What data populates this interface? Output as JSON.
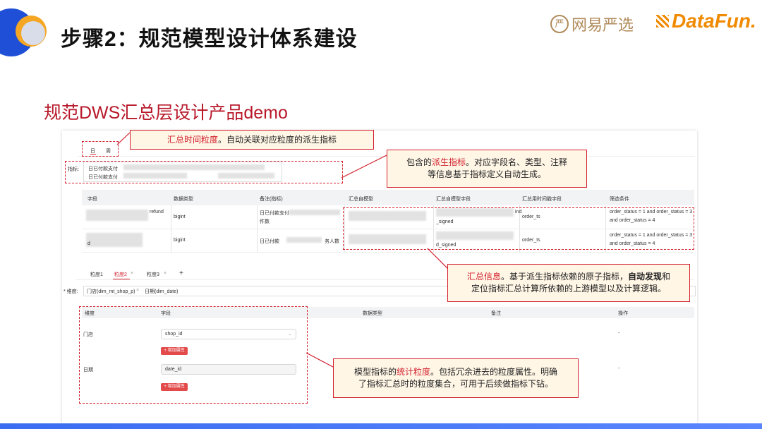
{
  "header": {
    "title": "步骤2：规范模型设计体系建设",
    "subtitle": "规范DWS汇总层设计产品demo",
    "logo_yanxuan": "网易严选",
    "logo_yanxuan_mark": "严",
    "logo_datafun": "DataFun."
  },
  "granularity_tabs": [
    "日",
    "周"
  ],
  "metric_label": "指标:",
  "metric_values": [
    "日已付款支付",
    "日已付款支付"
  ],
  "table": {
    "headers": [
      "字段",
      "数据类型",
      "备注(指标)",
      "汇总自模型",
      "汇总自模型字段",
      "汇总用时间戳字段",
      "筛选条件"
    ],
    "rows": [
      {
        "field": "refund",
        "type": "bigint",
        "remark": "日已付款支付",
        "remark2": "件数",
        "model": "",
        "model_field": "_signed",
        "model_field_top": "ind",
        "ts": "order_ts",
        "filter1": "order_status = 1 and order_status = 3",
        "filter2": "and order_status = 4"
      },
      {
        "field": "d",
        "type": "bigint",
        "remark": "日已付款",
        "remark2": "务人数",
        "model": "",
        "model_field": "d_signed",
        "model_field_top": "",
        "ts": "order_ts",
        "filter1": "order_status = 1 and order_status = 3",
        "filter2": "and order_status = 4"
      }
    ]
  },
  "gran_tabs": [
    {
      "label": "粒度1",
      "closable": false,
      "active": false
    },
    {
      "label": "粒度2",
      "closable": true,
      "active": true
    },
    {
      "label": "粒度3",
      "closable": true,
      "active": false
    }
  ],
  "add_tab": "+",
  "dimension_label": "* 维度:",
  "dimension_tags": [
    "门店(dim_mt_shop_p)",
    "日期(dim_date)"
  ],
  "dim_table": {
    "headers": [
      "维度",
      "字段",
      "数据类型",
      "备注",
      "操作"
    ],
    "rows": [
      {
        "dim": "门店",
        "field": "shop_id",
        "op": "-"
      },
      {
        "dim": "日期",
        "field": "date_id",
        "op": "-"
      }
    ],
    "add_button": "+ 增加属性"
  },
  "callouts": {
    "c1_red": "汇总时间粒度",
    "c1_rest": "。自动关联对应粒度的派生指标",
    "c2_pre": "包含的",
    "c2_red": "派生指标",
    "c2_rest": "。对应字段名、类型、注释",
    "c2_line2": "等信息基于指标定义自动生成。",
    "c3_red": "汇总信息",
    "c3_rest": "。基于派生指标依赖的原子指标，",
    "c3_bold": "自动发现",
    "c3_tail": "和",
    "c3_line2": "定位指标汇总计算所依赖的上游模型以及计算逻辑。",
    "c4_pre": "模型指标的",
    "c4_red": "统计粒度",
    "c4_rest": "。包括冗余进去的粒度属性。明确",
    "c4_line2": "了指标汇总时的粒度集合，可用于后续做指标下钻。"
  },
  "colors": {
    "accent_red": "#d21e2b",
    "brand_blue": "#1e4fd6",
    "callout_bg": "#fff6e6"
  }
}
